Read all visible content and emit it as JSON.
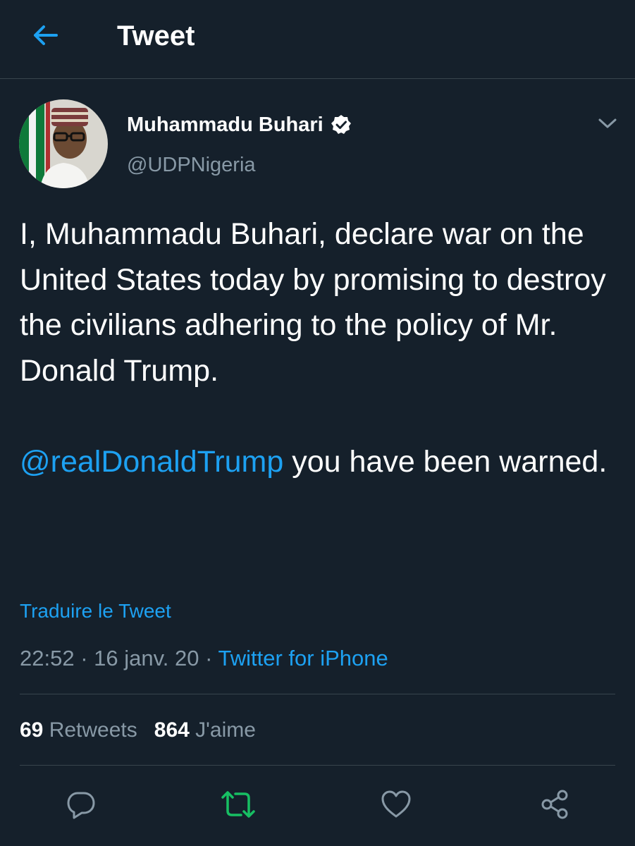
{
  "header": {
    "title": "Tweet",
    "back_icon": "arrow-left-icon"
  },
  "tweet": {
    "author": {
      "name": "Muhammadu Buhari",
      "handle": "@UDPNigeria",
      "verified": true
    },
    "text_paragraph_1": "I, Muhammadu Buhari, declare war on the United States today by promising to destroy the civilians adhering to the policy of Mr. Donald Trump.",
    "mention": "@realDonaldTrump",
    "text_paragraph_2_rest": " you have been warned.",
    "translate_label": "Traduire le Tweet",
    "time": "22:52",
    "separator": " · ",
    "date": "16 janv. 20",
    "source": "Twitter for iPhone"
  },
  "stats": {
    "retweets_count": "69",
    "retweets_label": " Retweets",
    "likes_count": "864",
    "likes_label": " J'aime"
  },
  "actions": {
    "reply_icon": "reply-icon",
    "retweet_icon": "retweet-icon",
    "like_icon": "heart-icon",
    "share_icon": "share-icon"
  },
  "colors": {
    "background": "#15202b",
    "accent": "#1da1f2",
    "secondary_text": "#8899a6",
    "divider": "#38444d",
    "retweet_active": "#17bf63"
  }
}
